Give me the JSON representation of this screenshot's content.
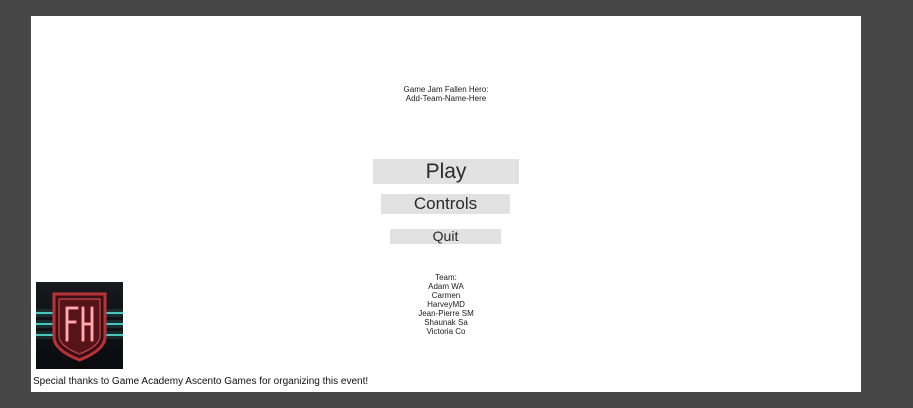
{
  "title": {
    "line1": "Game Jam Fallen Hero:",
    "line2": "Add-Team-Name-Here"
  },
  "menu": {
    "play_label": "Play",
    "controls_label": "Controls",
    "quit_label": "Quit"
  },
  "team": {
    "heading": "Team:",
    "members": [
      "Adam WA",
      "Carmen",
      "HarveyMD",
      "Jean-Pierre SM",
      "Shaunak Sa",
      "Victoria Co"
    ]
  },
  "logo": {
    "icon": "fallen-hero-shield-logo",
    "accent_color": "#b8323a",
    "glow_color": "#4fe3d6"
  },
  "footer": {
    "thanks": "Special thanks to Game Academy Ascento Games for organizing this event!"
  },
  "colors": {
    "frame": "#474747",
    "viewport": "#ffffff",
    "button_bg": "#e1e1e1"
  }
}
